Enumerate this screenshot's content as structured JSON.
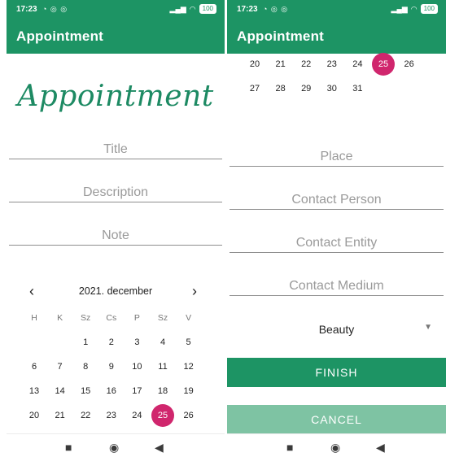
{
  "status": {
    "time": "17:23",
    "battery": "100"
  },
  "appbar": {
    "title": "Appointment"
  },
  "left": {
    "logo_text": "Appointment",
    "fields": [
      {
        "placeholder": "Title"
      },
      {
        "placeholder": "Description"
      },
      {
        "placeholder": "Note"
      }
    ],
    "calendar": {
      "month_label": "2021. december",
      "weekdays": [
        "H",
        "K",
        "Sz",
        "Cs",
        "P",
        "Sz",
        "V"
      ],
      "weeks": [
        [
          "",
          "",
          "1",
          "2",
          "3",
          "4",
          "5"
        ],
        [
          "6",
          "7",
          "8",
          "9",
          "10",
          "11",
          "12"
        ],
        [
          "13",
          "14",
          "15",
          "16",
          "17",
          "18",
          "19"
        ],
        [
          "20",
          "21",
          "22",
          "23",
          "24",
          "25",
          "26"
        ]
      ],
      "selected_day": "25",
      "selected_color": "#d0266d"
    }
  },
  "right": {
    "calendar_rows": [
      [
        "20",
        "21",
        "22",
        "23",
        "24",
        "25",
        "26"
      ],
      [
        "27",
        "28",
        "29",
        "30",
        "31",
        "",
        ""
      ]
    ],
    "fields": [
      {
        "placeholder": "Place"
      },
      {
        "placeholder": "Contact Person"
      },
      {
        "placeholder": "Contact Entity"
      },
      {
        "placeholder": "Contact Medium"
      }
    ],
    "category_select": {
      "value": "Beauty"
    },
    "finish_label": "FINISH",
    "cancel_label": "CANCEL"
  },
  "colors": {
    "primary": "#1d9464",
    "primary_light": "#7ec3a3",
    "accent": "#d0266d"
  },
  "icons": {
    "prev": "chevron-left-icon",
    "next": "chevron-right-icon",
    "dropdown": "caret-down-icon",
    "nav": [
      "square-icon",
      "circle-icon",
      "triangle-back-icon"
    ]
  }
}
